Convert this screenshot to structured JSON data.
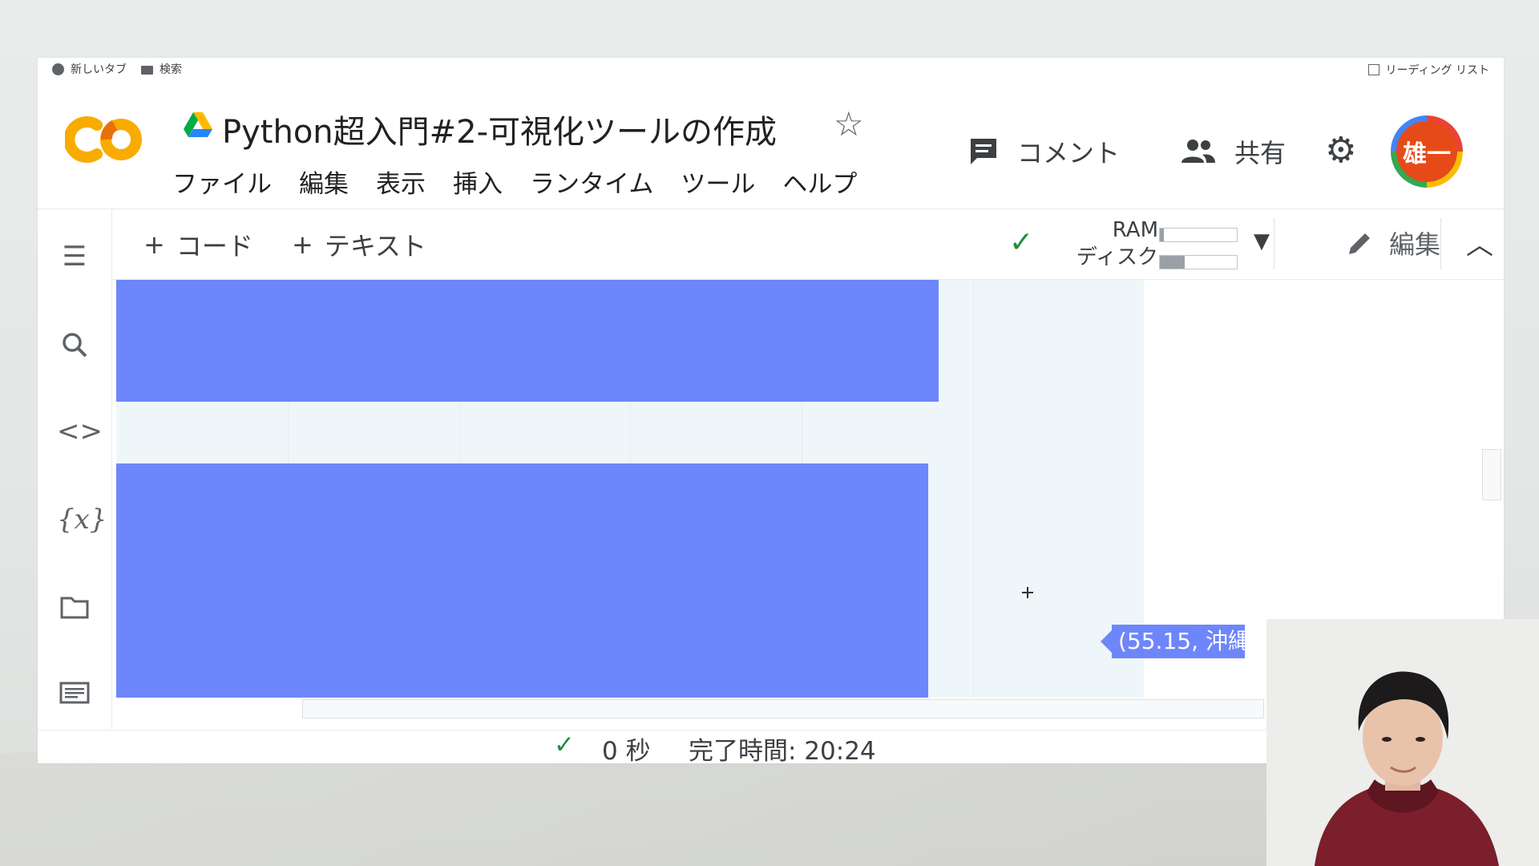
{
  "bookmarks": [
    {
      "label": "新しいタブ",
      "icon": "globe-icon"
    },
    {
      "label": "検索",
      "icon": "folder-icon"
    }
  ],
  "reading_list": "リーディング リスト",
  "notebook_title": "Python超入門#2-可視化ツールの作成",
  "menu": [
    "ファイル",
    "編集",
    "表示",
    "挿入",
    "ランタイム",
    "ツール",
    "ヘルプ"
  ],
  "header": {
    "comment_label": "コメント",
    "share_label": "共有",
    "avatar_text": "雄一"
  },
  "toolbar": {
    "add_code_label": "コード",
    "add_text_label": "テキスト",
    "ram_label": "RAM",
    "disk_label": "ディスク",
    "ram_usage": 0.05,
    "disk_usage": 0.32,
    "edit_label": "編集"
  },
  "plot": {
    "bar_color": "#6e86fb",
    "bar_extents": [
      0.8,
      0.79
    ],
    "hover_label": "(55.15, 沖縄"
  },
  "status": {
    "duration": "0 秒",
    "completed": "完了時間: 20:24"
  }
}
